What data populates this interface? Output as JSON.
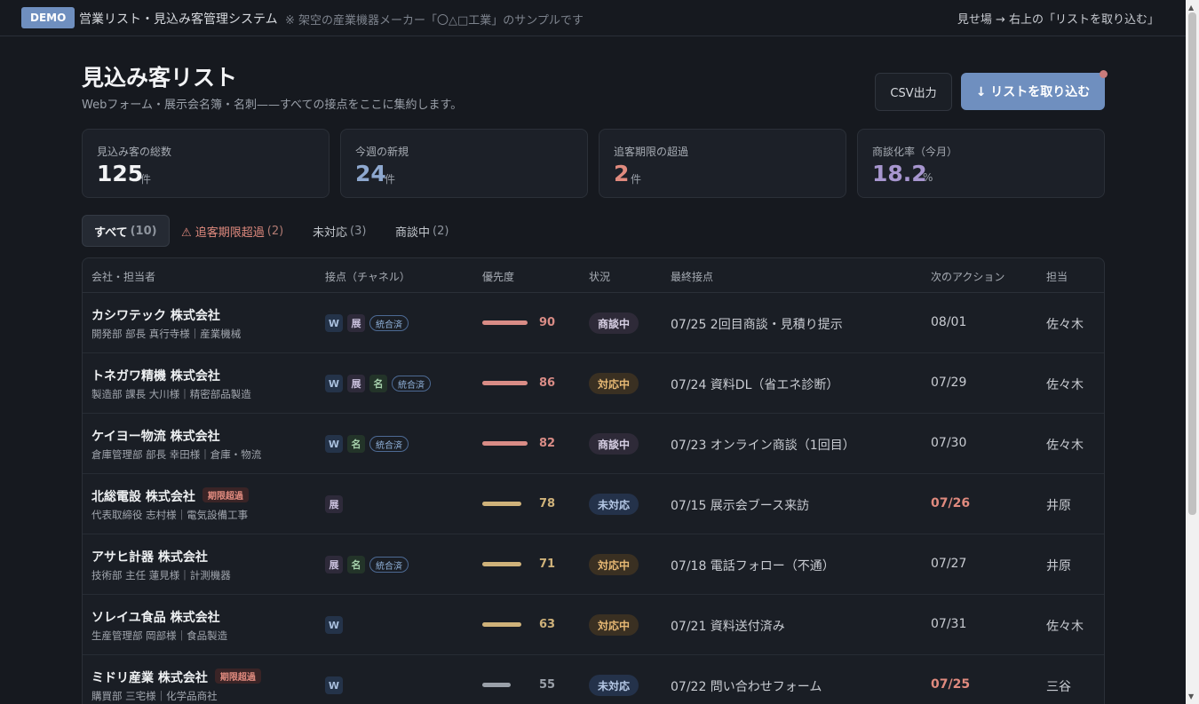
{
  "topbar": {
    "demo_label": "DEMO",
    "title": "営業リスト・見込み客管理システム",
    "note": "※ 架空の産業機器メーカー「〇△□工業」のサンプルです",
    "hint": "見せ場 → 右上の「リストを取り込む」"
  },
  "header": {
    "title": "見込み客リスト",
    "subtitle": "Webフォーム・展示会名簿・名刺——すべての接点をここに集約します。",
    "csv_label": "CSV出力",
    "import_label": "↓ リストを取り込む"
  },
  "stats": [
    {
      "label": "見込み客の総数",
      "value": "125",
      "unit": "件",
      "color": "#f2f3f5"
    },
    {
      "label": "今週の新規",
      "value": "24",
      "unit": "件",
      "color": "#8ea8cf"
    },
    {
      "label": "追客期限の超過",
      "value": "2",
      "unit": "件",
      "color": "#e08a7e"
    },
    {
      "label": "商談化率（今月）",
      "value": "18.2",
      "unit": "%",
      "color": "#a796cf"
    }
  ],
  "tabs": [
    {
      "label": "すべて",
      "count": "(10)"
    },
    {
      "label": "⚠ 追客期限超過",
      "count": "(2)"
    },
    {
      "label": "未対応",
      "count": "(3)"
    },
    {
      "label": "商談中",
      "count": "(2)"
    }
  ],
  "columns": [
    "会社・担当者",
    "接点（チャネル）",
    "優先度",
    "状況",
    "最終接点",
    "次のアクション",
    "担当"
  ],
  "overdue_tag": "期限超過",
  "merged_label": "統合済",
  "channel_labels": {
    "w": "W",
    "ex": "展",
    "nm": "名"
  },
  "colors": {
    "high": "#d98c86",
    "mid": "#cfb27a",
    "low": "#9aa0a9",
    "overdue": "#e08a7e"
  },
  "rows": [
    {
      "company": "カシワテック 株式会社",
      "overdue": false,
      "contact": "開発部 部長 真行寺様｜産業機械",
      "channels": [
        "w",
        "ex"
      ],
      "merged": true,
      "priority": 90,
      "status": "商談中",
      "status_kind": "nego",
      "last": "07/25 2回目商談・見積り提示",
      "next": "08/01",
      "next_late": false,
      "owner": "佐々木"
    },
    {
      "company": "トネガワ精機 株式会社",
      "overdue": false,
      "contact": "製造部 課長 大川様｜精密部品製造",
      "channels": [
        "w",
        "ex",
        "nm"
      ],
      "merged": true,
      "priority": 86,
      "status": "対応中",
      "status_kind": "prog",
      "last": "07/24 資料DL（省エネ診断）",
      "next": "07/29",
      "next_late": false,
      "owner": "佐々木"
    },
    {
      "company": "ケイヨー物流 株式会社",
      "overdue": false,
      "contact": "倉庫管理部 部長 幸田様｜倉庫・物流",
      "channels": [
        "w",
        "nm"
      ],
      "merged": true,
      "priority": 82,
      "status": "商談中",
      "status_kind": "nego",
      "last": "07/23 オンライン商談（1回目）",
      "next": "07/30",
      "next_late": false,
      "owner": "佐々木"
    },
    {
      "company": "北総電設 株式会社",
      "overdue": true,
      "contact": "代表取締役 志村様｜電気設備工事",
      "channels": [
        "ex"
      ],
      "merged": false,
      "priority": 78,
      "status": "未対応",
      "status_kind": "none",
      "last": "07/15 展示会ブース来訪",
      "next": "07/26",
      "next_late": true,
      "owner": "井原"
    },
    {
      "company": "アサヒ計器 株式会社",
      "overdue": false,
      "contact": "技術部 主任 蓮見様｜計測機器",
      "channels": [
        "ex",
        "nm"
      ],
      "merged": true,
      "priority": 71,
      "status": "対応中",
      "status_kind": "prog",
      "last": "07/18 電話フォロー（不通）",
      "next": "07/27",
      "next_late": false,
      "owner": "井原"
    },
    {
      "company": "ソレイユ食品 株式会社",
      "overdue": false,
      "contact": "生産管理部 岡部様｜食品製造",
      "channels": [
        "w"
      ],
      "merged": false,
      "priority": 63,
      "status": "対応中",
      "status_kind": "prog",
      "last": "07/21 資料送付済み",
      "next": "07/31",
      "next_late": false,
      "owner": "佐々木"
    },
    {
      "company": "ミドリ産業 株式会社",
      "overdue": true,
      "contact": "購買部 三宅様｜化学品商社",
      "channels": [
        "w"
      ],
      "merged": false,
      "priority": 55,
      "status": "未対応",
      "status_kind": "none",
      "last": "07/22 問い合わせフォーム",
      "next": "07/25",
      "next_late": true,
      "owner": "三谷"
    }
  ]
}
